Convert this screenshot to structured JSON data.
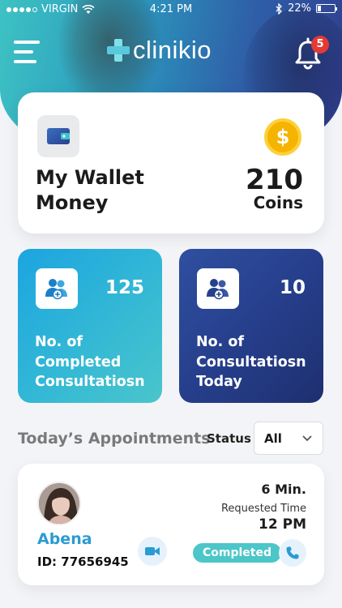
{
  "status_bar": {
    "carrier": "VIRGIN",
    "time": "4:21 PM",
    "battery_percent": "22%",
    "battery_level": 0.22
  },
  "header": {
    "logo_text": "clinikio",
    "notification_count": "5",
    "menu_icon": "hamburger-icon",
    "bell_icon": "bell-icon"
  },
  "wallet": {
    "title": "My Wallet Money",
    "amount": "210",
    "unit": "Coins",
    "wallet_icon": "wallet-icon",
    "coin_icon": "dollar-coin-icon"
  },
  "stats": [
    {
      "value": "125",
      "label": "No. of Completed Consultatiosn",
      "icon": "users-add-icon"
    },
    {
      "value": "10",
      "label": "No. of Consultatiosn Today",
      "icon": "users-add-icon"
    }
  ],
  "appointments": {
    "section_title": "Today’s Appointments",
    "status_label": "Status",
    "status_selected": "All",
    "items": [
      {
        "name": "Abena",
        "id_text": "ID: 77656945",
        "duration": "6 Min.",
        "requested_label": "Requested Time",
        "requested_time": "12 PM",
        "status": "Completed"
      }
    ]
  },
  "colors": {
    "accent_teal": "#4cc6c8",
    "accent_blue": "#2b9bd3",
    "dark_navy": "#263f8c",
    "badge_red": "#e53935",
    "coin_gold": "#f5b400"
  }
}
